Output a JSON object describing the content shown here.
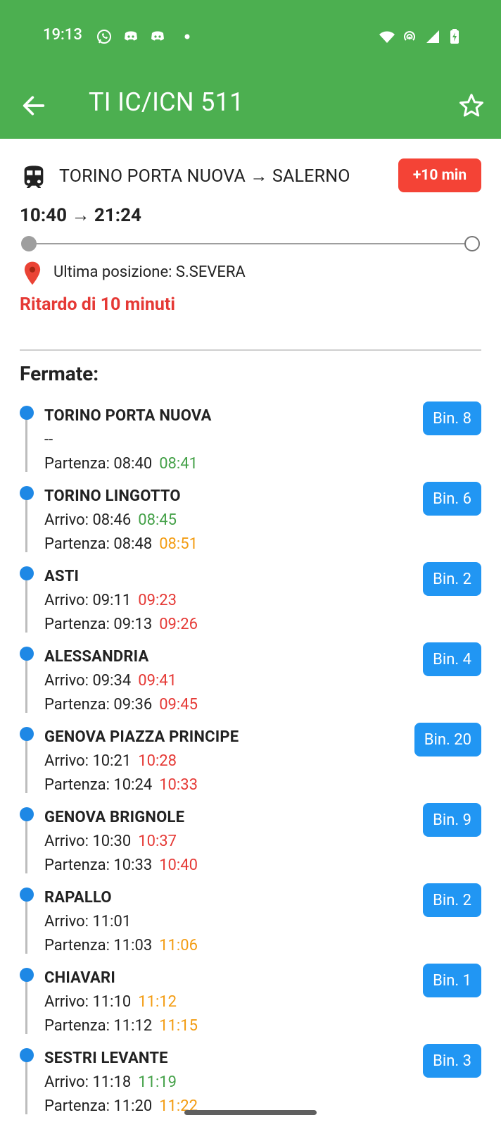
{
  "status_bar": {
    "time": "19:13",
    "icons": [
      "whatsapp-icon",
      "discord-icon",
      "discord-icon",
      "dot-icon",
      "wifi-icon",
      "hotspot-icon",
      "signal-icon",
      "battery-charging-icon"
    ]
  },
  "app_bar": {
    "title": "TI IC/ICN 511",
    "back_icon": "arrow-back-icon",
    "favorite_icon": "star-outline-icon"
  },
  "train": {
    "icon": "train-icon",
    "route": "TORINO PORTA NUOVA → SALERNO",
    "delay_badge": "+10 min",
    "times": "10:40 → 21:24",
    "last_position": "Ultima posizione: S.SEVERA",
    "delay_text": "Ritardo di 10 minuti"
  },
  "stops_title": "Fermate:",
  "colors": {
    "appbar": "#4caf50",
    "badge_red": "#f44336",
    "platform_blue": "#2196f3",
    "on_time_green": "#43a047",
    "slight_delay_orange": "#f39c12",
    "delay_red": "#e53935"
  },
  "stops": [
    {
      "name": "TORINO PORTA NUOVA",
      "l1": "--",
      "l1_actual": "",
      "l1_status": "",
      "l2": "Partenza: 08:40",
      "l2_actual": "08:41",
      "l2_status": "green",
      "platform": "Bin. 8"
    },
    {
      "name": "TORINO LINGOTTO",
      "l1": "Arrivo: 08:46",
      "l1_actual": "08:45",
      "l1_status": "green",
      "l2": "Partenza: 08:48",
      "l2_actual": "08:51",
      "l2_status": "orange",
      "platform": "Bin. 6"
    },
    {
      "name": "ASTI",
      "l1": "Arrivo: 09:11",
      "l1_actual": "09:23",
      "l1_status": "red",
      "l2": "Partenza: 09:13",
      "l2_actual": "09:26",
      "l2_status": "red",
      "platform": "Bin. 2"
    },
    {
      "name": "ALESSANDRIA",
      "l1": "Arrivo: 09:34",
      "l1_actual": "09:41",
      "l1_status": "red",
      "l2": "Partenza: 09:36",
      "l2_actual": "09:45",
      "l2_status": "red",
      "platform": "Bin. 4"
    },
    {
      "name": "GENOVA PIAZZA PRINCIPE",
      "l1": "Arrivo: 10:21",
      "l1_actual": "10:28",
      "l1_status": "red",
      "l2": "Partenza: 10:24",
      "l2_actual": "10:33",
      "l2_status": "red",
      "platform": "Bin. 20"
    },
    {
      "name": "GENOVA BRIGNOLE",
      "l1": "Arrivo: 10:30",
      "l1_actual": "10:37",
      "l1_status": "red",
      "l2": "Partenza: 10:33",
      "l2_actual": "10:40",
      "l2_status": "red",
      "platform": "Bin. 9"
    },
    {
      "name": "RAPALLO",
      "l1": "Arrivo: 11:01",
      "l1_actual": "",
      "l1_status": "",
      "l2": "Partenza: 11:03",
      "l2_actual": "11:06",
      "l2_status": "orange",
      "platform": "Bin. 2"
    },
    {
      "name": "CHIAVARI",
      "l1": "Arrivo: 11:10",
      "l1_actual": "11:12",
      "l1_status": "orange",
      "l2": "Partenza: 11:12",
      "l2_actual": "11:15",
      "l2_status": "orange",
      "platform": "Bin. 1"
    },
    {
      "name": "SESTRI LEVANTE",
      "l1": "Arrivo: 11:18",
      "l1_actual": "11:19",
      "l1_status": "green",
      "l2": "Partenza: 11:20",
      "l2_actual": "11:22",
      "l2_status": "orange",
      "platform": "Bin. 3"
    }
  ]
}
